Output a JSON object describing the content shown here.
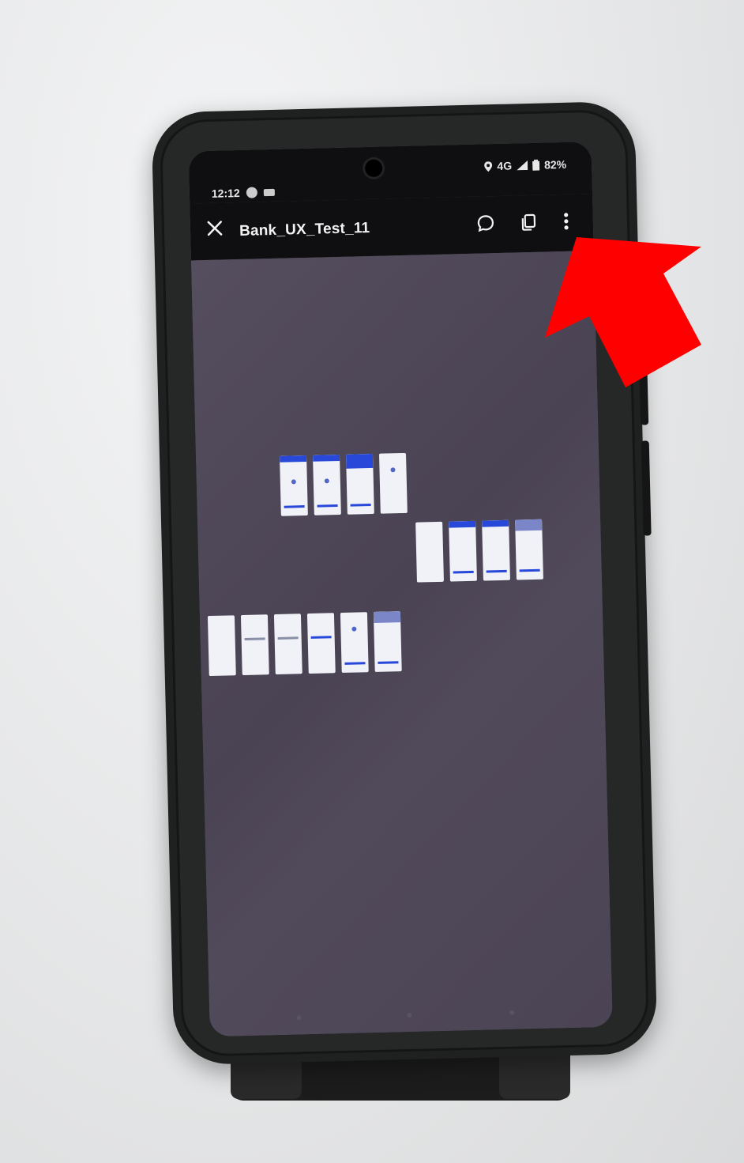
{
  "status_bar": {
    "time": "12:12",
    "network": "4G",
    "battery": "82%"
  },
  "app_bar": {
    "title": "Bank_UX_Test_11",
    "actions": [
      {
        "name": "comment-icon"
      },
      {
        "name": "copy-icon"
      },
      {
        "name": "more-options-icon"
      }
    ]
  },
  "canvas": {
    "frame_rows": [
      {
        "count": 4
      },
      {
        "count": 4
      },
      {
        "count": 6
      }
    ]
  },
  "annotation": {
    "pointer_color": "#ff0000",
    "target": "more-options-icon"
  },
  "colors": {
    "app_bar_bg": "#0f0f11",
    "canvas_bg": "#4d4656",
    "frame_accent": "#2748d8"
  }
}
